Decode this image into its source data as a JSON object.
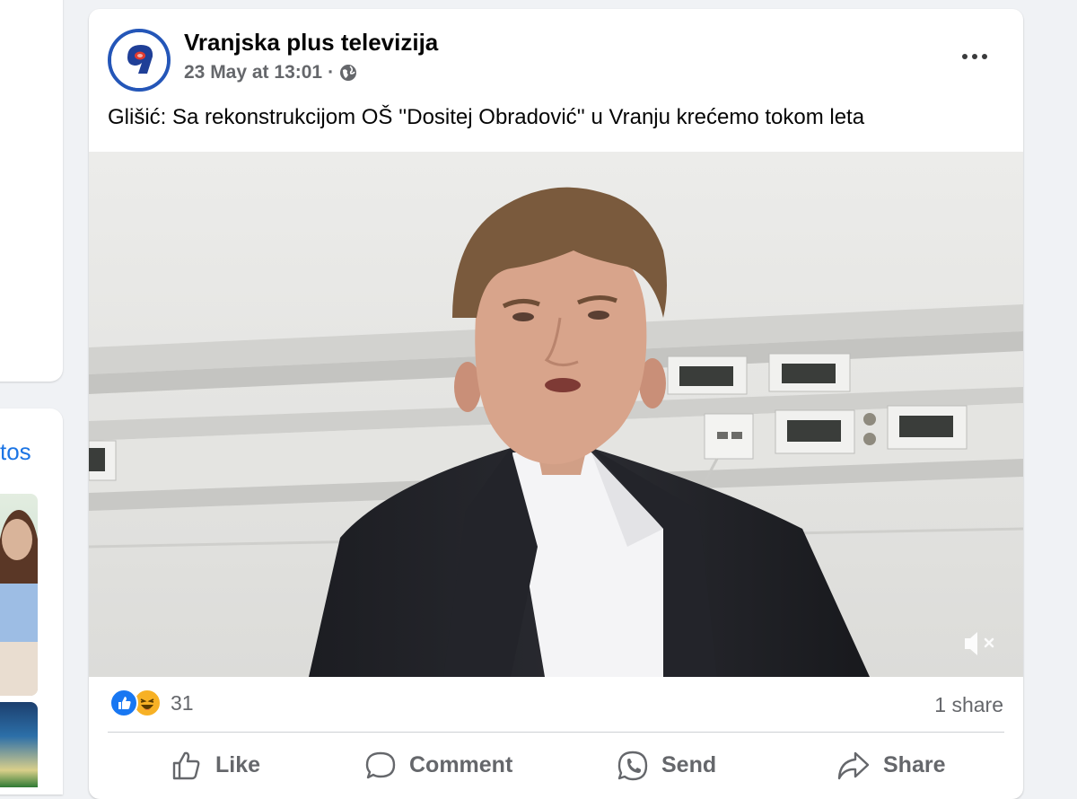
{
  "left_column": {
    "photos_link_fragment": "tos"
  },
  "post": {
    "page_name": "Vranjska plus televizija",
    "timestamp": "23 May at 13:01",
    "separator": "·",
    "audience_icon": "globe-icon",
    "more_icon": "more-options-icon",
    "avatar_glyph": "9",
    "caption": "Glišić: Sa rekonstrukcijom OŠ ''Dositej Obradović'' u Vranju krećemo tokom leta",
    "video": {
      "muted_icon": "speaker-muted-icon"
    },
    "reactions": {
      "types": [
        "like",
        "haha"
      ],
      "count": "31"
    },
    "shares": "1 share",
    "actions": {
      "like": "Like",
      "comment": "Comment",
      "send": "Send",
      "share": "Share"
    }
  },
  "colors": {
    "background": "#f0f2f5",
    "card": "#ffffff",
    "brand_blue": "#1877f2",
    "secondary_text": "#65676b",
    "avatar_ring": "#2456b8"
  }
}
